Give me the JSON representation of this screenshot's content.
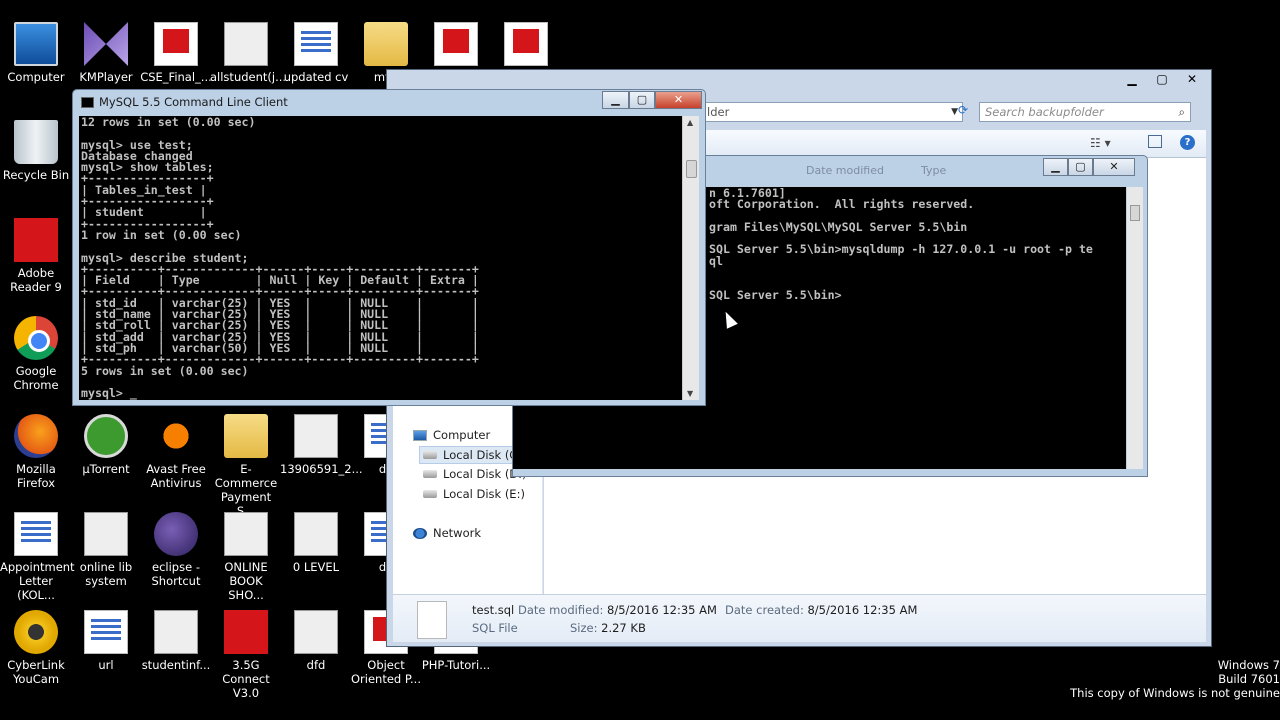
{
  "desktop_icons": [
    {
      "label": "Computer",
      "icon": "computer-icon"
    },
    {
      "label": "KMPlayer",
      "icon": "kmplayer-icon"
    },
    {
      "label": "CSE_Final_...",
      "icon": "pdf-file-icon"
    },
    {
      "label": "allstudent(j...",
      "icon": "image-file-icon"
    },
    {
      "label": "updated cv",
      "icon": "word-doc-icon"
    },
    {
      "label": "mvc",
      "icon": "folder-icon"
    },
    {
      "label": "",
      "icon": "pdf-file-icon"
    },
    {
      "label": "",
      "icon": "pdf-file-icon"
    },
    {
      "label": "Recycle Bin",
      "icon": "recycle-bin-icon"
    },
    {
      "label": "Adobe Reader 9",
      "icon": "adobe-reader-icon"
    },
    {
      "label": "Google Chrome",
      "icon": "chrome-icon"
    },
    {
      "label": "Mozilla Firefox",
      "icon": "firefox-icon"
    },
    {
      "label": "µTorrent",
      "icon": "utorrent-icon"
    },
    {
      "label": "Avast Free Antivirus",
      "icon": "avast-icon"
    },
    {
      "label": "E-Commerce Payment S...",
      "icon": "folder-icon"
    },
    {
      "label": "13906591_2...",
      "icon": "photo-file-icon"
    },
    {
      "label": "de",
      "icon": "file-icon"
    },
    {
      "label": "Appointment Letter  (KOL...",
      "icon": "word-doc-icon"
    },
    {
      "label": "online lib system",
      "icon": "image-file-icon"
    },
    {
      "label": "eclipse - Shortcut",
      "icon": "eclipse-icon"
    },
    {
      "label": "ONLINE BOOK SHO...",
      "icon": "image-file-icon"
    },
    {
      "label": "0 LEVEL",
      "icon": "image-file-icon"
    },
    {
      "label": "de",
      "icon": "file-icon"
    },
    {
      "label": "CyberLink YouCam",
      "icon": "youcam-icon"
    },
    {
      "label": "url",
      "icon": "text-file-icon"
    },
    {
      "label": "studentinf...",
      "icon": "image-file-icon"
    },
    {
      "label": "3.5G Connect V3.0",
      "icon": "airtel-icon"
    },
    {
      "label": "dfd",
      "icon": "image-file-icon"
    },
    {
      "label": "Object Oriented P...",
      "icon": "pdf-file-icon"
    },
    {
      "label": "PHP-Tutori...",
      "icon": "pdf-file-icon"
    }
  ],
  "mysql_console": {
    "title": "MySQL 5.5 Command Line Client",
    "lines": [
      "12 rows in set (0.00 sec)",
      "",
      "mysql> use test;",
      "Database changed",
      "mysql> show tables;",
      "+-----------------+",
      "| Tables_in_test |",
      "+-----------------+",
      "| student        |",
      "+-----------------+",
      "1 row in set (0.00 sec)",
      "",
      "mysql> describe student;",
      "+----------+-------------+------+-----+---------+-------+",
      "| Field    | Type        | Null | Key | Default | Extra |",
      "+----------+-------------+------+-----+---------+-------+",
      "| std_id   | varchar(25) | YES  |     | NULL    |       |",
      "| std_name | varchar(25) | YES  |     | NULL    |       |",
      "| std_roll | varchar(25) | YES  |     | NULL    |       |",
      "| std_add  | varchar(25) | YES  |     | NULL    |       |",
      "| std_ph   | varchar(50) | YES  |     | NULL    |       |",
      "+----------+-------------+------+-----+---------+-------+",
      "5 rows in set (0.00 sec)",
      "",
      "mysql> _"
    ]
  },
  "cmd_window": {
    "lines": [
      "n 6.1.7601]",
      "oft Corporation.  All rights reserved.",
      "",
      "gram Files\\MySQL\\MySQL Server 5.5\\bin",
      "",
      "SQL Server 5.5\\bin>mysqldump -h 127.0.0.1 -u root -p te",
      "ql",
      "",
      "",
      "SQL Server 5.5\\bin>"
    ],
    "hidden_headers": [
      "Date modified",
      "Type"
    ]
  },
  "explorer": {
    "address": "lder",
    "search_placeholder": "Search backupfolder",
    "nav": [
      {
        "label": "Computer",
        "icon": "computer-icon"
      },
      {
        "label": "Local Disk (C:)",
        "icon": "disk-icon"
      },
      {
        "label": "Local Disk (D:)",
        "icon": "disk-icon"
      },
      {
        "label": "Local Disk (E:)",
        "icon": "disk-icon"
      },
      {
        "label": "Network",
        "icon": "network-icon"
      }
    ],
    "details": {
      "file_name": "test.sql",
      "file_type": "SQL File",
      "date_modified_label": "Date modified:",
      "date_modified": "8/5/2016 12:35 AM",
      "size_label": "Size:",
      "size": "2.27 KB",
      "date_created_label": "Date created:",
      "date_created": "8/5/2016 12:35 AM"
    }
  },
  "watermark": {
    "line1": "Windows 7",
    "line2": "Build 7601",
    "line3": "This copy of Windows is not genuine"
  },
  "colors": {
    "console_bg": "#000000",
    "console_text": "#c0c0c0",
    "desktop_bg": "#000000"
  }
}
